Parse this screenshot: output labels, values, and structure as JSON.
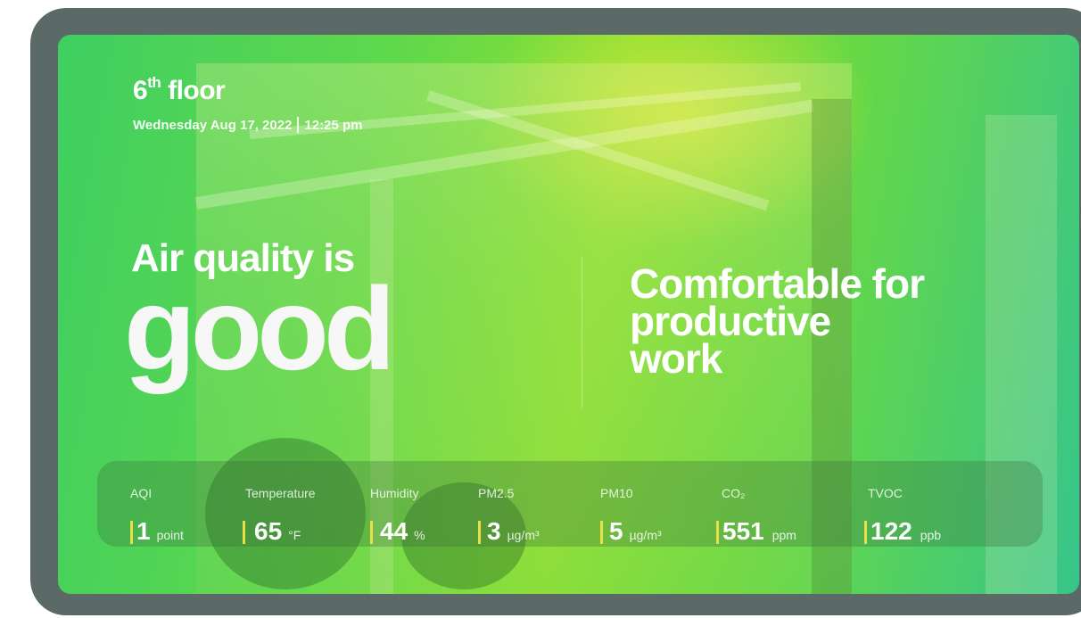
{
  "header": {
    "floor_number": "6",
    "floor_suffix": "th",
    "floor_word": "floor",
    "date": "Wednesday Aug 17, 2022",
    "time": "12:25 pm"
  },
  "status": {
    "headline": "Air quality is",
    "quality_word": "good",
    "comfort_line1": "Comfortable for",
    "comfort_line2": "productive",
    "comfort_line3": "work"
  },
  "metrics": [
    {
      "label": "AQI",
      "value": "1",
      "unit": "point"
    },
    {
      "label": "Temperature",
      "value": "65",
      "unit": "°F"
    },
    {
      "label": "Humidity",
      "value": "44",
      "unit": "%"
    },
    {
      "label": "PM2.5",
      "value": "3",
      "unit": "µg/m³"
    },
    {
      "label": "PM10",
      "value": "5",
      "unit": "µg/m³"
    },
    {
      "label": "CO₂",
      "value": "551",
      "unit": "ppm"
    },
    {
      "label": "TVOC",
      "value": "122",
      "unit": "ppb"
    }
  ],
  "colors": {
    "accent_bar": "#e9e049",
    "device_frame": "#5b6a66",
    "screen_green": "#5fd84c"
  }
}
